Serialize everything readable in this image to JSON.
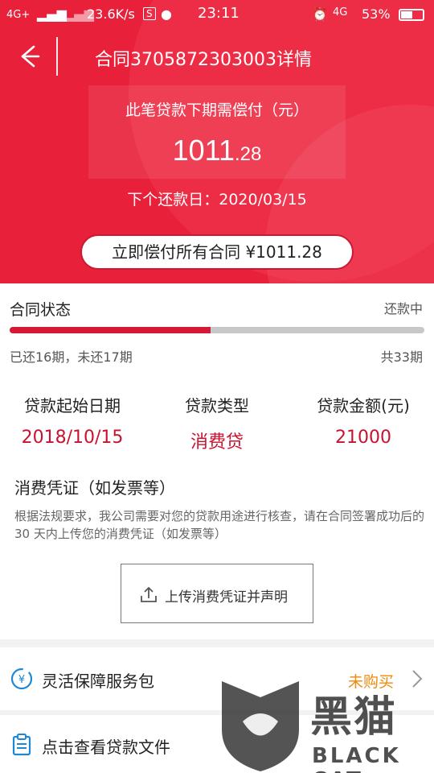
{
  "status_bar": {
    "network": "4G+",
    "speed": "23.6K/s",
    "s_badge": "S",
    "time": "23:11",
    "network2": "4G",
    "battery": "53%"
  },
  "nav": {
    "title": "合同3705872303003详情"
  },
  "summary": {
    "due_label": "此笔贷款下期需偿付（元）",
    "due_amount_int": "1011",
    "due_amount_dec": ".28",
    "next_date": "下个还款日：2020/03/15",
    "pay_all_label": "立即偿付所有合同 ¥1011.28"
  },
  "contract": {
    "status_title": "合同状态",
    "status_value": "还款中",
    "progress_fraction": 0.485,
    "paid_text": "已还16期，未还17期",
    "total_text": "共33期",
    "start_date_label": "贷款起始日期",
    "start_date_value": "2018/10/15",
    "type_label": "贷款类型",
    "type_value": "消费贷",
    "amount_label": "贷款金额(元)",
    "amount_value": "21000"
  },
  "voucher": {
    "title": "消费凭证（如发票等）",
    "description": "根据法规要求，我公司需要对您的贷款用途进行核查，请在合同签署成功后的30 天内上传您的消费凭证（如发票等）",
    "upload_label": "上传消费凭证并声明"
  },
  "rows": [
    {
      "label": "灵活保障服务包",
      "status": "未购买",
      "icon": "yuan-shield-icon"
    },
    {
      "label": "点击查看贷款文件",
      "status": "",
      "icon": "clipboard-icon"
    }
  ],
  "watermark": {
    "cn": "黑猫",
    "en": "BLACK CAT"
  },
  "colors": {
    "brand_red": "#e8203a",
    "amount_red": "#c8122f",
    "orange": "#f08a0a"
  }
}
